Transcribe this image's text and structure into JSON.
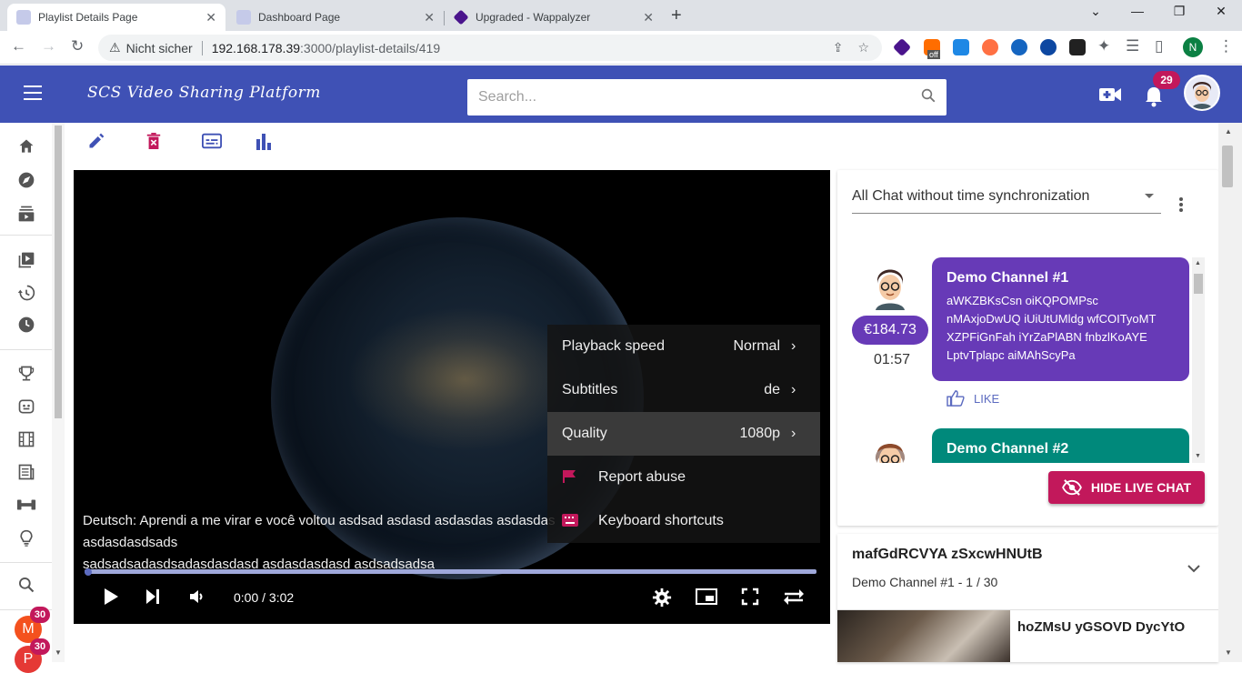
{
  "browser": {
    "tabs": [
      {
        "title": "Playlist Details Page",
        "active": true
      },
      {
        "title": "Dashboard Page",
        "active": false
      },
      {
        "title": "Upgraded - Wappalyzer",
        "active": false
      }
    ],
    "address": {
      "security_label": "Nicht sicher",
      "host": "192.168.178.39",
      "path": ":3000/playlist-details/419"
    },
    "profile_initial": "N",
    "extension_badge": "off"
  },
  "app": {
    "brand": "SCS Video Sharing Platform",
    "search_placeholder": "Search...",
    "notification_count": "29"
  },
  "sidebar": {
    "items": [
      "home-icon",
      "explore-icon",
      "subscriptions-icon",
      "library-icon",
      "history-icon",
      "watch-later-icon",
      "trophy-icon",
      "gamepad-icon",
      "movies-icon",
      "news-icon",
      "sports-icon",
      "lightbulb-icon",
      "search-icon"
    ],
    "channels": [
      {
        "initial": "M",
        "badge": "30",
        "color": "#f4511e"
      },
      {
        "initial": "P",
        "badge": "30",
        "color": "#e53935"
      }
    ]
  },
  "toolbar": [
    "edit-icon",
    "delete-icon",
    "subtitles-icon",
    "stats-icon"
  ],
  "player": {
    "subtitle_line1": "Deutsch: Aprendi a me virar e você voltou asdsad asdasd asdasdas asdasdas asdasdasdsads",
    "subtitle_line2": "sadsadsadasdsadasdasdasd asdasdasdasd asdsadsadsa",
    "time": "0:00 / 3:02",
    "settings": [
      {
        "label": "Playback speed",
        "value": "Normal"
      },
      {
        "label": "Subtitles",
        "value": "de"
      },
      {
        "label": "Quality",
        "value": "1080p"
      },
      {
        "label": "Report abuse"
      },
      {
        "label": "Keyboard shortcuts"
      }
    ]
  },
  "chat": {
    "mode": "All Chat without time synchronization",
    "messages": [
      {
        "channel": "Demo Channel #1",
        "text": "aWKZBKsCsn oiKQPOMPsc nMAxjoDwUQ iUiUtUMldg wfCOITyoMT XZPFiGnFah iYrZaPlABN fnbzlKoAYE LptvTplapc aiMAhScyPa",
        "donation": "€184.73",
        "time": "01:57",
        "like_label": "LIKE",
        "color": "#673ab7"
      },
      {
        "channel": "Demo Channel #2",
        "color": "#00897b"
      }
    ],
    "hide_label": "HIDE LIVE CHAT"
  },
  "playlist": {
    "title": "mafGdRCVYA zSxcwHNUtB",
    "subtitle": "Demo Channel #1 - 1 / 30",
    "first_video_title": "hoZMsU yGSOVD DycYtO"
  }
}
